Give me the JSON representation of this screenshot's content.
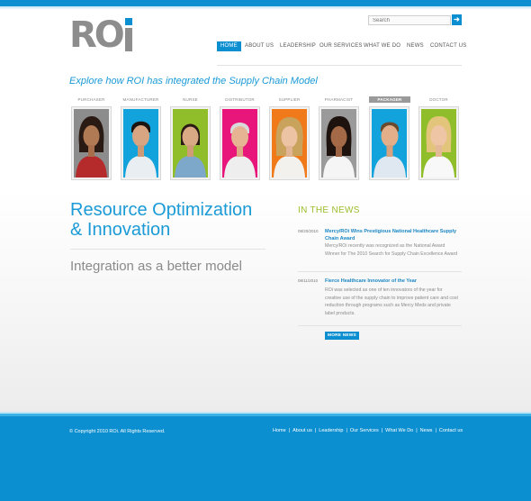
{
  "header": {
    "logo_text": "RO",
    "search": {
      "placeholder": "Search",
      "button_icon": "arrow-right-icon"
    }
  },
  "nav": {
    "items": [
      {
        "label": "HOME",
        "active": true
      },
      {
        "label": "ABOUT US"
      },
      {
        "label": "LEADERSHIP"
      },
      {
        "label": "OUR SERVICES"
      },
      {
        "label": "WHAT WE DO"
      },
      {
        "label": "NEWS"
      },
      {
        "label": "CONTACT US"
      }
    ]
  },
  "tagline": "Explore how ROI has integrated the Supply Chain Model",
  "roles": [
    {
      "label": "PURCHASER",
      "bg": "#8c8c8c"
    },
    {
      "label": "MANUFACTURER",
      "bg": "#12a3dc"
    },
    {
      "label": "NURSE",
      "bg": "#8fbe2a"
    },
    {
      "label": "DISTRIBUTOR",
      "bg": "#e8157a"
    },
    {
      "label": "SUPPLIER",
      "bg": "#f07a1a"
    },
    {
      "label": "PHARMACIST",
      "bg": "#9a9a9a"
    },
    {
      "label": "PACKAGER",
      "bg": "#12a3dc",
      "active": true
    },
    {
      "label": "DOCTOR",
      "bg": "#8fbe2a"
    }
  ],
  "main": {
    "headline_line1": "Resource Optimization",
    "headline_line2": "& Innovation",
    "subhead": "Integration as a better model"
  },
  "news": {
    "title": "IN THE NEWS",
    "items": [
      {
        "date": "08/20/2010",
        "headline": "Mercy/ROi Wins Prestigious National Healthcare Supply Chain Award",
        "body": "Mercy/ROi recently was recognized as the National Award Winner for The 2010 Search for Supply Chain Excellence Award"
      },
      {
        "date": "08/11/2010",
        "headline": "Fierce Healthcare Innovator of the Year",
        "body": "ROi was selected as one of ten innovators of the year for creative use of the supply chain to improve patient care and cost reduction through programs such as Mercy Meds and private label products."
      }
    ],
    "more_label": "MORE NEWS"
  },
  "footer": {
    "copyright": "© Copyright 2010 ROi. All Rights Reserved.",
    "links": [
      "Home",
      "About us",
      "Leadership",
      "Our Services",
      "What We Do",
      "News",
      "Contact us"
    ],
    "separator": "|"
  },
  "colors": {
    "accent": "#0b8fd0",
    "news_title": "#9bbe2b"
  }
}
